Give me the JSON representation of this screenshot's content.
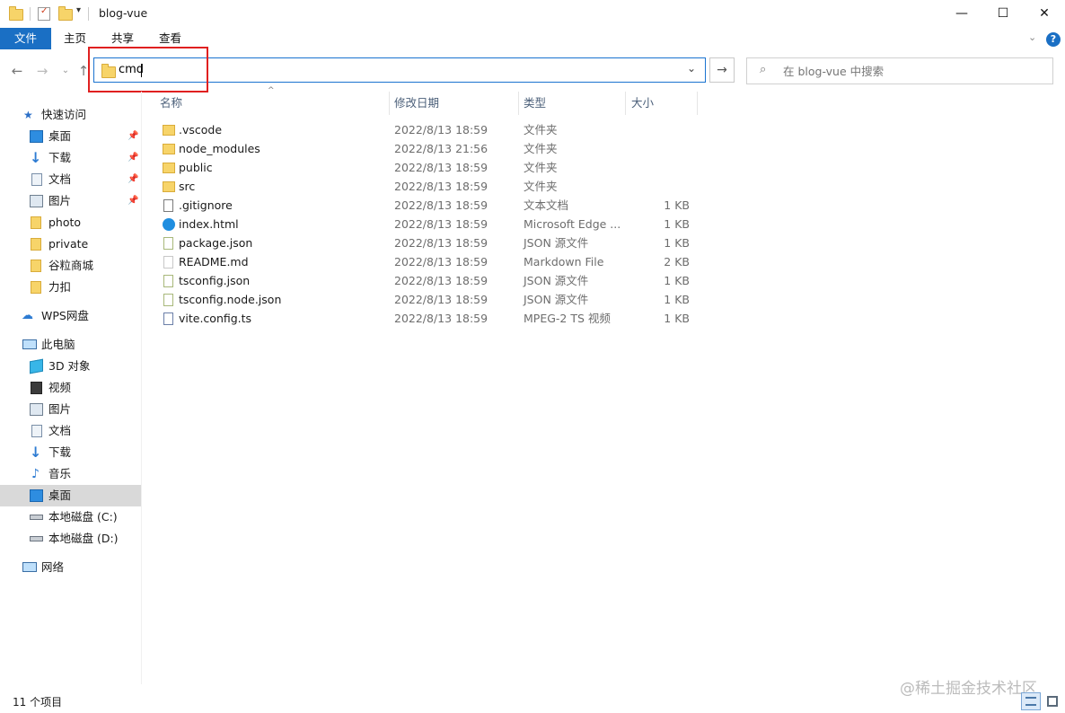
{
  "window": {
    "title": "blog-vue"
  },
  "ribbon": {
    "tabs": [
      "文件",
      "主页",
      "共享",
      "查看"
    ]
  },
  "address": {
    "value": "cmd"
  },
  "search": {
    "placeholder": "在 blog-vue 中搜索"
  },
  "sidebar": {
    "quick_access": "快速访问",
    "quick_items": [
      "桌面",
      "下载",
      "文档",
      "图片",
      "photo",
      "private",
      "谷粒商城",
      "力扣"
    ],
    "wps": "WPS网盘",
    "this_pc": "此电脑",
    "pc_items": [
      "3D 对象",
      "视频",
      "图片",
      "文档",
      "下载",
      "音乐",
      "桌面",
      "本地磁盘 (C:)",
      "本地磁盘 (D:)"
    ],
    "network": "网络"
  },
  "columns": {
    "name": "名称",
    "date": "修改日期",
    "type": "类型",
    "size": "大小"
  },
  "files": [
    {
      "name": ".vscode",
      "date": "2022/8/13 18:59",
      "type": "文件夹",
      "size": "",
      "icon": "folder"
    },
    {
      "name": "node_modules",
      "date": "2022/8/13 21:56",
      "type": "文件夹",
      "size": "",
      "icon": "folder"
    },
    {
      "name": "public",
      "date": "2022/8/13 18:59",
      "type": "文件夹",
      "size": "",
      "icon": "folder"
    },
    {
      "name": "src",
      "date": "2022/8/13 18:59",
      "type": "文件夹",
      "size": "",
      "icon": "folder"
    },
    {
      "name": ".gitignore",
      "date": "2022/8/13 18:59",
      "type": "文本文档",
      "size": "1 KB",
      "icon": "text"
    },
    {
      "name": "index.html",
      "date": "2022/8/13 18:59",
      "type": "Microsoft Edge ...",
      "size": "1 KB",
      "icon": "edge"
    },
    {
      "name": "package.json",
      "date": "2022/8/13 18:59",
      "type": "JSON 源文件",
      "size": "1 KB",
      "icon": "json"
    },
    {
      "name": "README.md",
      "date": "2022/8/13 18:59",
      "type": "Markdown File",
      "size": "2 KB",
      "icon": "markdown"
    },
    {
      "name": "tsconfig.json",
      "date": "2022/8/13 18:59",
      "type": "JSON 源文件",
      "size": "1 KB",
      "icon": "json"
    },
    {
      "name": "tsconfig.node.json",
      "date": "2022/8/13 18:59",
      "type": "JSON 源文件",
      "size": "1 KB",
      "icon": "json"
    },
    {
      "name": "vite.config.ts",
      "date": "2022/8/13 18:59",
      "type": "MPEG-2 TS 视频",
      "size": "1 KB",
      "icon": "video"
    }
  ],
  "status": {
    "count": "11 个项目"
  },
  "watermark": "@稀土掘金技术社区"
}
